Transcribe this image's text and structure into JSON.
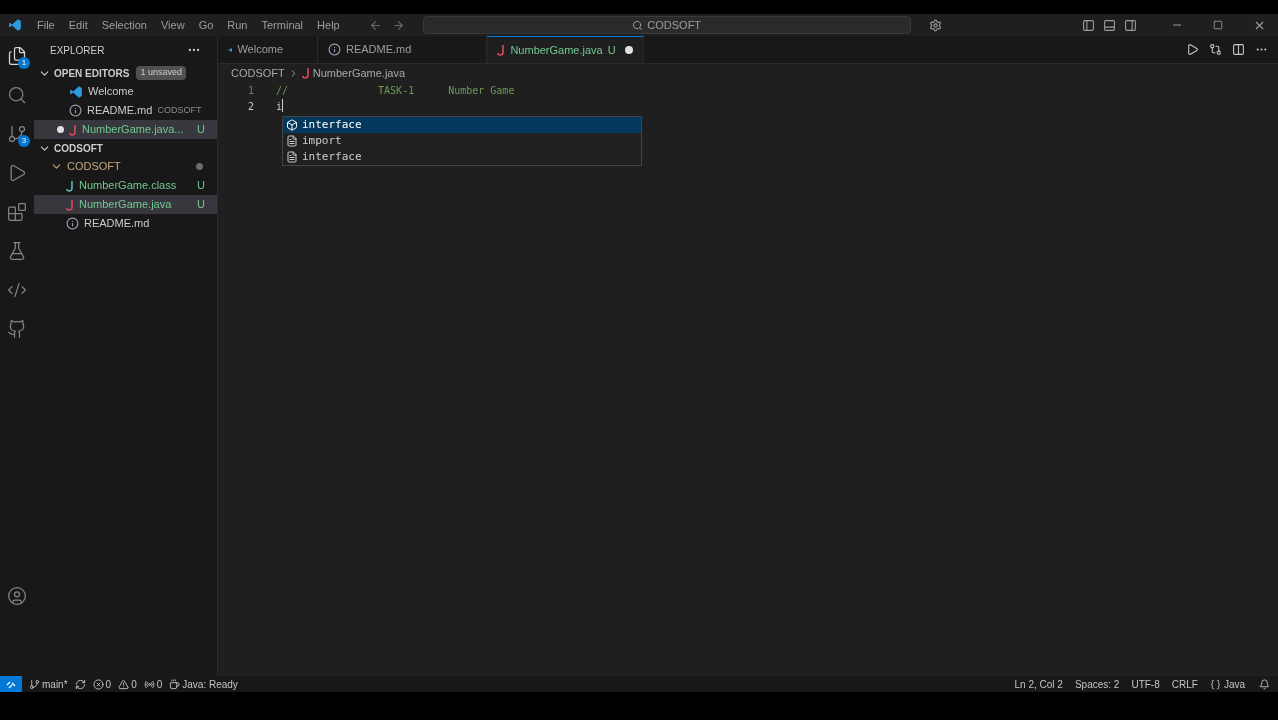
{
  "menu": [
    "File",
    "Edit",
    "Selection",
    "View",
    "Go",
    "Run",
    "Terminal",
    "Help"
  ],
  "command_center": "CODSOFT",
  "activity_bar": [
    {
      "kind": "files",
      "badge": "1",
      "selected": true
    },
    {
      "kind": "search",
      "selected": false
    },
    {
      "kind": "scm",
      "badge": "3",
      "selected": false
    },
    {
      "kind": "debug",
      "selected": false
    },
    {
      "kind": "extensions",
      "selected": false
    },
    {
      "kind": "testing",
      "selected": false
    },
    {
      "kind": "python",
      "selected": false
    },
    {
      "kind": "github",
      "selected": false
    }
  ],
  "sidebar": {
    "title": "EXPLORER",
    "open_editors": {
      "label": "OPEN EDITORS",
      "badge": "1 unsaved",
      "expanded": true,
      "items": [
        {
          "kind": "vscode",
          "name": "Welcome",
          "selected": false,
          "dirty": false
        },
        {
          "kind": "info",
          "name": "README.md",
          "detail": "CODSOFT",
          "selected": false,
          "dirty": false
        },
        {
          "kind": "java",
          "name": "NumberGame.java...",
          "status": "U",
          "selected": true,
          "dirty": true
        }
      ]
    },
    "folder": {
      "label": "CODSOFT",
      "expanded": true,
      "children": [
        {
          "label": "CODSOFT",
          "expanded": true,
          "modified": true,
          "children": [
            {
              "kind": "java-class",
              "name": "NumberGame.class",
              "status": "U",
              "selected": false
            },
            {
              "kind": "java",
              "name": "NumberGame.java",
              "status": "U",
              "selected": true
            },
            {
              "kind": "info",
              "name": "README.md",
              "selected": false
            }
          ]
        }
      ]
    }
  },
  "tabs": [
    {
      "kind": "vscode",
      "label": "Welcome",
      "selected": false
    },
    {
      "kind": "info",
      "label": "README.md",
      "selected": false
    },
    {
      "kind": "java",
      "label": "NumberGame.java",
      "status": "U",
      "dirty": true,
      "selected": true
    }
  ],
  "breadcrumb": [
    "CODSOFT",
    "NumberGame.java"
  ],
  "code": [
    {
      "number": "1",
      "parts": [
        "//",
        "TASK-1",
        "Number Game"
      ],
      "current": false
    },
    {
      "number": "2",
      "parts": [
        "i"
      ],
      "current": true
    }
  ],
  "suggestions": [
    {
      "kind": "class",
      "label": "interface",
      "selected": true
    },
    {
      "kind": "snippet",
      "label": "import",
      "selected": false
    },
    {
      "kind": "snippet",
      "label": "interface",
      "selected": false
    }
  ],
  "status_bar": {
    "left": [
      {
        "kind": "branch",
        "text": "main*"
      },
      {
        "kind": "sync"
      },
      {
        "kind": "errors",
        "text": "0"
      },
      {
        "kind": "warnings",
        "text": "0"
      },
      {
        "kind": "ports",
        "text": "0"
      },
      {
        "kind": "java",
        "text": "Java: Ready"
      }
    ],
    "right": [
      {
        "kind": "text",
        "text": "Ln 2, Col 2"
      },
      {
        "kind": "text",
        "text": "Spaces: 2"
      },
      {
        "kind": "text",
        "text": "UTF-8"
      },
      {
        "kind": "text",
        "text": "CRLF"
      },
      {
        "kind": "lang",
        "text": "Java"
      },
      {
        "kind": "bell"
      }
    ]
  }
}
